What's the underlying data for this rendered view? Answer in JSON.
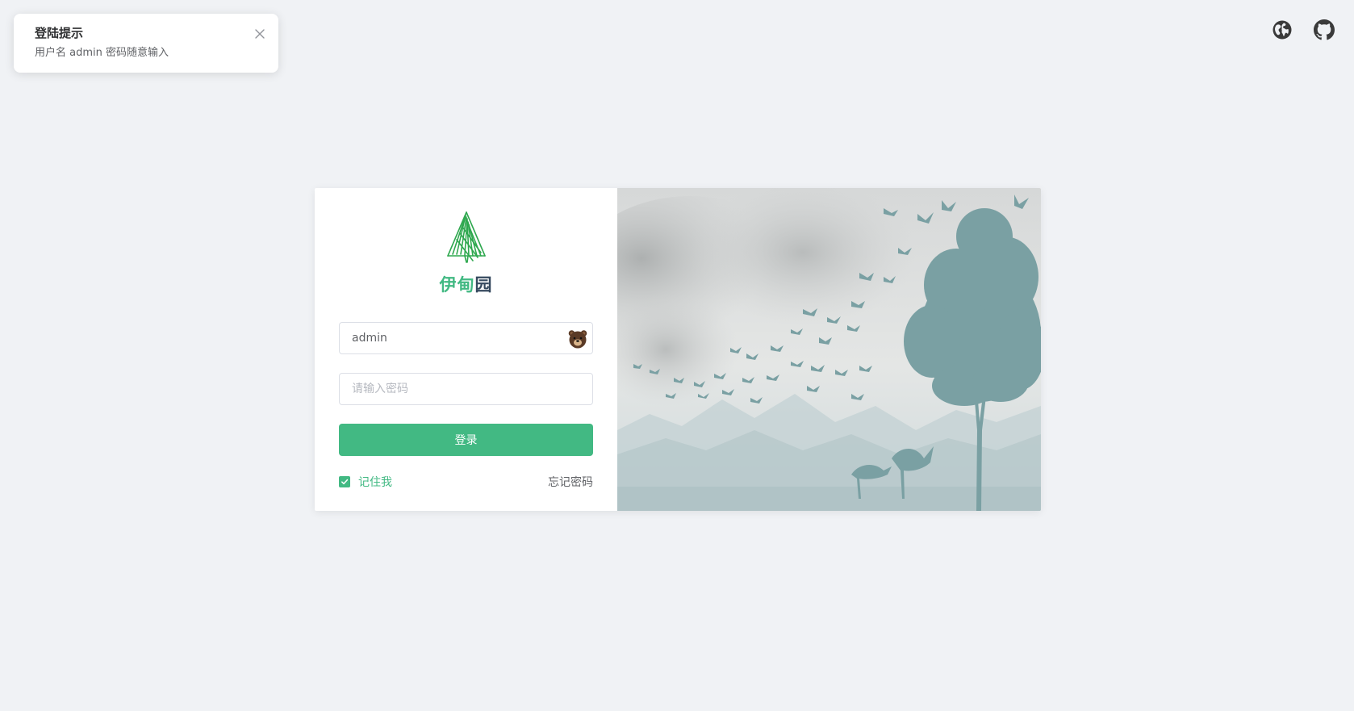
{
  "notification": {
    "title": "登陆提示",
    "message": "用户名 admin 密码随意输入"
  },
  "top_icons": [
    "globe-icon",
    "github-icon"
  ],
  "brand": {
    "part1": "伊甸",
    "part2": "园",
    "colors": {
      "primary": "#42b983",
      "secondary": "#35495e"
    }
  },
  "form": {
    "username_value": "admin",
    "password_placeholder": "请输入密码",
    "login_label": "登录",
    "remember_label": "记住我",
    "remember_checked": true,
    "forgot_label": "忘记密码"
  },
  "colors": {
    "accent": "#42b983",
    "background": "#f0f2f5",
    "illustration": "#7aa0a3"
  }
}
